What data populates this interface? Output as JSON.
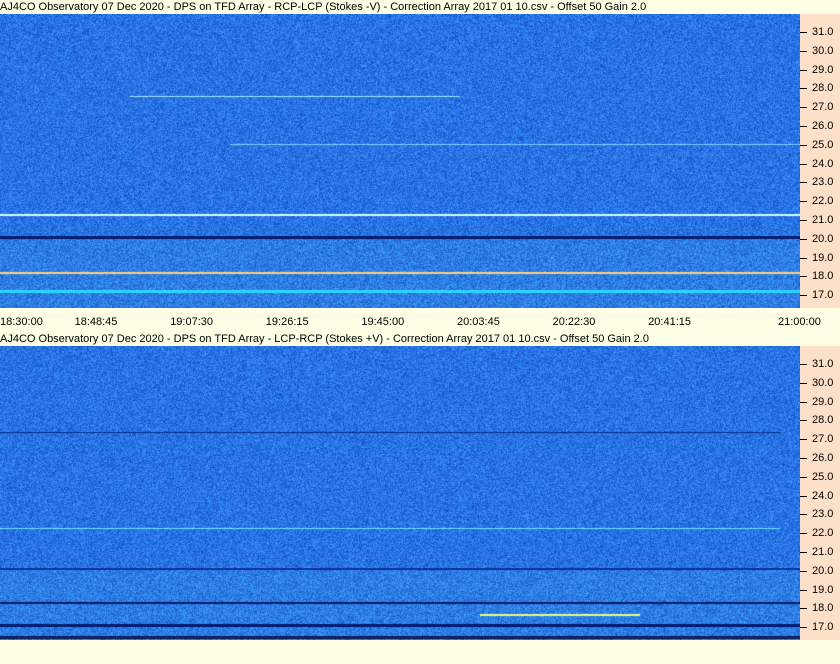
{
  "panels": [
    {
      "title": "AJ4CO Observatory 07 Dec 2020  -  DPS on TFD Array  -  RCP-LCP (Stokes -V)  -  Correction Array 2017 01 10.csv  -  Offset 50  Gain 2.0",
      "freq_labels": [
        "31.0",
        "30.0",
        "29.0",
        "28.0",
        "27.0",
        "26.0",
        "25.0",
        "24.0",
        "23.0",
        "22.0",
        "21.0",
        "20.0",
        "19.0",
        "18.0",
        "17.0"
      ]
    },
    {
      "title": "AJ4CO Observatory 07 Dec 2020  -  DPS on TFD Array  -  LCP-RCP (Stokes +V)  -  Correction Array 2017 01 10.csv  -  Offset 50  Gain 2.0",
      "freq_labels": [
        "31.0",
        "30.0",
        "29.0",
        "28.0",
        "27.0",
        "26.0",
        "25.0",
        "24.0",
        "23.0",
        "22.0",
        "21.0",
        "20.0",
        "19.0",
        "18.0",
        "17.0"
      ]
    }
  ],
  "time_axis": {
    "labels": [
      "18:30:00",
      "18:48:45",
      "19:07:30",
      "19:26:15",
      "19:45:00",
      "20:03:45",
      "20:22:30",
      "20:41:15",
      "21:00:00"
    ]
  },
  "colors": {
    "background": "#ffffe6",
    "axis_bg": "#fce0c8",
    "spectrogram_base": "#1f5fd9"
  }
}
